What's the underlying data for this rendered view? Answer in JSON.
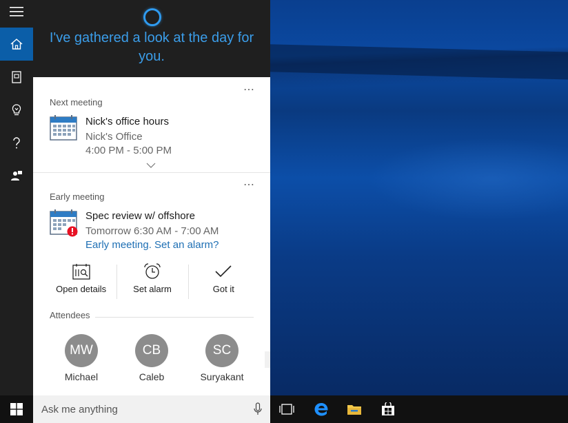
{
  "header": {
    "greeting": "I've gathered a look at the day for you."
  },
  "rail": {
    "items": [
      {
        "name": "menu",
        "icon": "hamburger-icon"
      },
      {
        "name": "home",
        "icon": "home-icon",
        "active": true
      },
      {
        "name": "notebook",
        "icon": "notebook-icon"
      },
      {
        "name": "lightbulb",
        "icon": "lightbulb-icon"
      },
      {
        "name": "help",
        "icon": "help-icon"
      },
      {
        "name": "feedback",
        "icon": "feedback-icon"
      }
    ]
  },
  "next_meeting": {
    "section": "Next meeting",
    "more": "⋯",
    "title": "Nick's office hours",
    "location": "Nick's Office",
    "time": "4:00 PM - 5:00 PM"
  },
  "early_meeting": {
    "section": "Early meeting",
    "more": "⋯",
    "title": "Spec review w/ offshore",
    "time": "Tomorrow 6:30 AM - 7:00 AM",
    "link": "Early meeting. Set an alarm?",
    "actions": [
      {
        "label": "Open details",
        "icon": "open-details-icon"
      },
      {
        "label": "Set alarm",
        "icon": "alarm-clock-icon"
      },
      {
        "label": "Got it",
        "icon": "checkmark-icon"
      }
    ],
    "attendees_label": "Attendees",
    "attendees": [
      {
        "initials": "MW",
        "name": "Michael"
      },
      {
        "initials": "CB",
        "name": "Caleb"
      },
      {
        "initials": "SC",
        "name": "Suryakant"
      }
    ]
  },
  "taskbar": {
    "search_placeholder": "Ask me anything",
    "pinned": [
      "task-view-icon",
      "edge-icon",
      "file-explorer-icon",
      "store-icon"
    ]
  },
  "colors": {
    "accent": "#0b5ea8",
    "cortana_text": "#3b9de9",
    "link": "#1e6fb4",
    "alert": "#e81123"
  }
}
